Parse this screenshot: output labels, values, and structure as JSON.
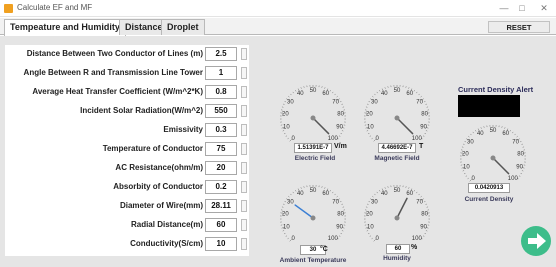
{
  "window": {
    "title": "Calculate EF and MF",
    "controls": {
      "minimize": "—",
      "maximize": "□",
      "close": "✕"
    }
  },
  "tabs": [
    {
      "label": "Tempeature and Humidity",
      "active": true
    },
    {
      "label": "Distance",
      "active": false
    },
    {
      "label": "Droplet",
      "active": false
    }
  ],
  "reset_label": "RESET",
  "parameters": [
    {
      "label": "Distance Between Two Conductor of Lines (m)",
      "value": "2.5"
    },
    {
      "label": "Angle Between R and Transmission Line Tower",
      "value": "1"
    },
    {
      "label": "Average Heat Transfer Coefficient (W/m^2*K)",
      "value": "0.8"
    },
    {
      "label": "Incident Solar Radiation(W/m^2)",
      "value": "550"
    },
    {
      "label": "Emissivity",
      "value": "0.3"
    },
    {
      "label": "Temperature of Conductor",
      "value": "75"
    },
    {
      "label": "AC Resistance(ohm/m)",
      "value": "20"
    },
    {
      "label": "Absorbity of Conductor",
      "value": "0.2"
    },
    {
      "label": "Diameter of Wire(mm)",
      "value": "28.11"
    },
    {
      "label": "Radial Distance(m)",
      "value": "60"
    },
    {
      "label": "Conductivity(S/cm)",
      "value": "10"
    }
  ],
  "gauges": {
    "electric_field": {
      "caption": "Electric Field",
      "value": "1.51391E-7",
      "unit": "V/m",
      "needle_value": 100,
      "ticks": [
        "0",
        "10",
        "20",
        "30",
        "40",
        "50",
        "60",
        "70",
        "80",
        "90",
        "100"
      ]
    },
    "magnetic_field": {
      "caption": "Magnetic Field",
      "value": "4.46692E-7",
      "unit": "T",
      "needle_value": 100,
      "ticks": [
        "0",
        "10",
        "20",
        "30",
        "40",
        "50",
        "60",
        "70",
        "80",
        "90",
        "100"
      ]
    },
    "ambient_temperature": {
      "caption": "Ambient Temperature",
      "value": "30",
      "unit": "°C",
      "needle_value": 30,
      "ticks": [
        "0",
        "10",
        "20",
        "30",
        "40",
        "50",
        "60",
        "70",
        "80",
        "90",
        "100"
      ]
    },
    "humidity": {
      "caption": "Humidity",
      "value": "60",
      "unit": "%",
      "needle_value": 60,
      "ticks": [
        "0",
        "10",
        "20",
        "30",
        "40",
        "50",
        "60",
        "70",
        "80",
        "90",
        "100"
      ]
    },
    "current_density": {
      "caption": "Current Density",
      "value": "0.0420913",
      "unit": "",
      "needle_value": 100,
      "ticks": [
        "0",
        "10",
        "20",
        "30",
        "40",
        "50",
        "60",
        "70",
        "80",
        "90",
        "100"
      ]
    }
  },
  "alert": {
    "title": "Current Density Alert",
    "color": "#000000"
  },
  "next_icon": "arrow-right-icon",
  "colors": {
    "accent": "#3dbd8a",
    "needle_blue": "#3b7fd4",
    "needle_gray": "#555555"
  }
}
